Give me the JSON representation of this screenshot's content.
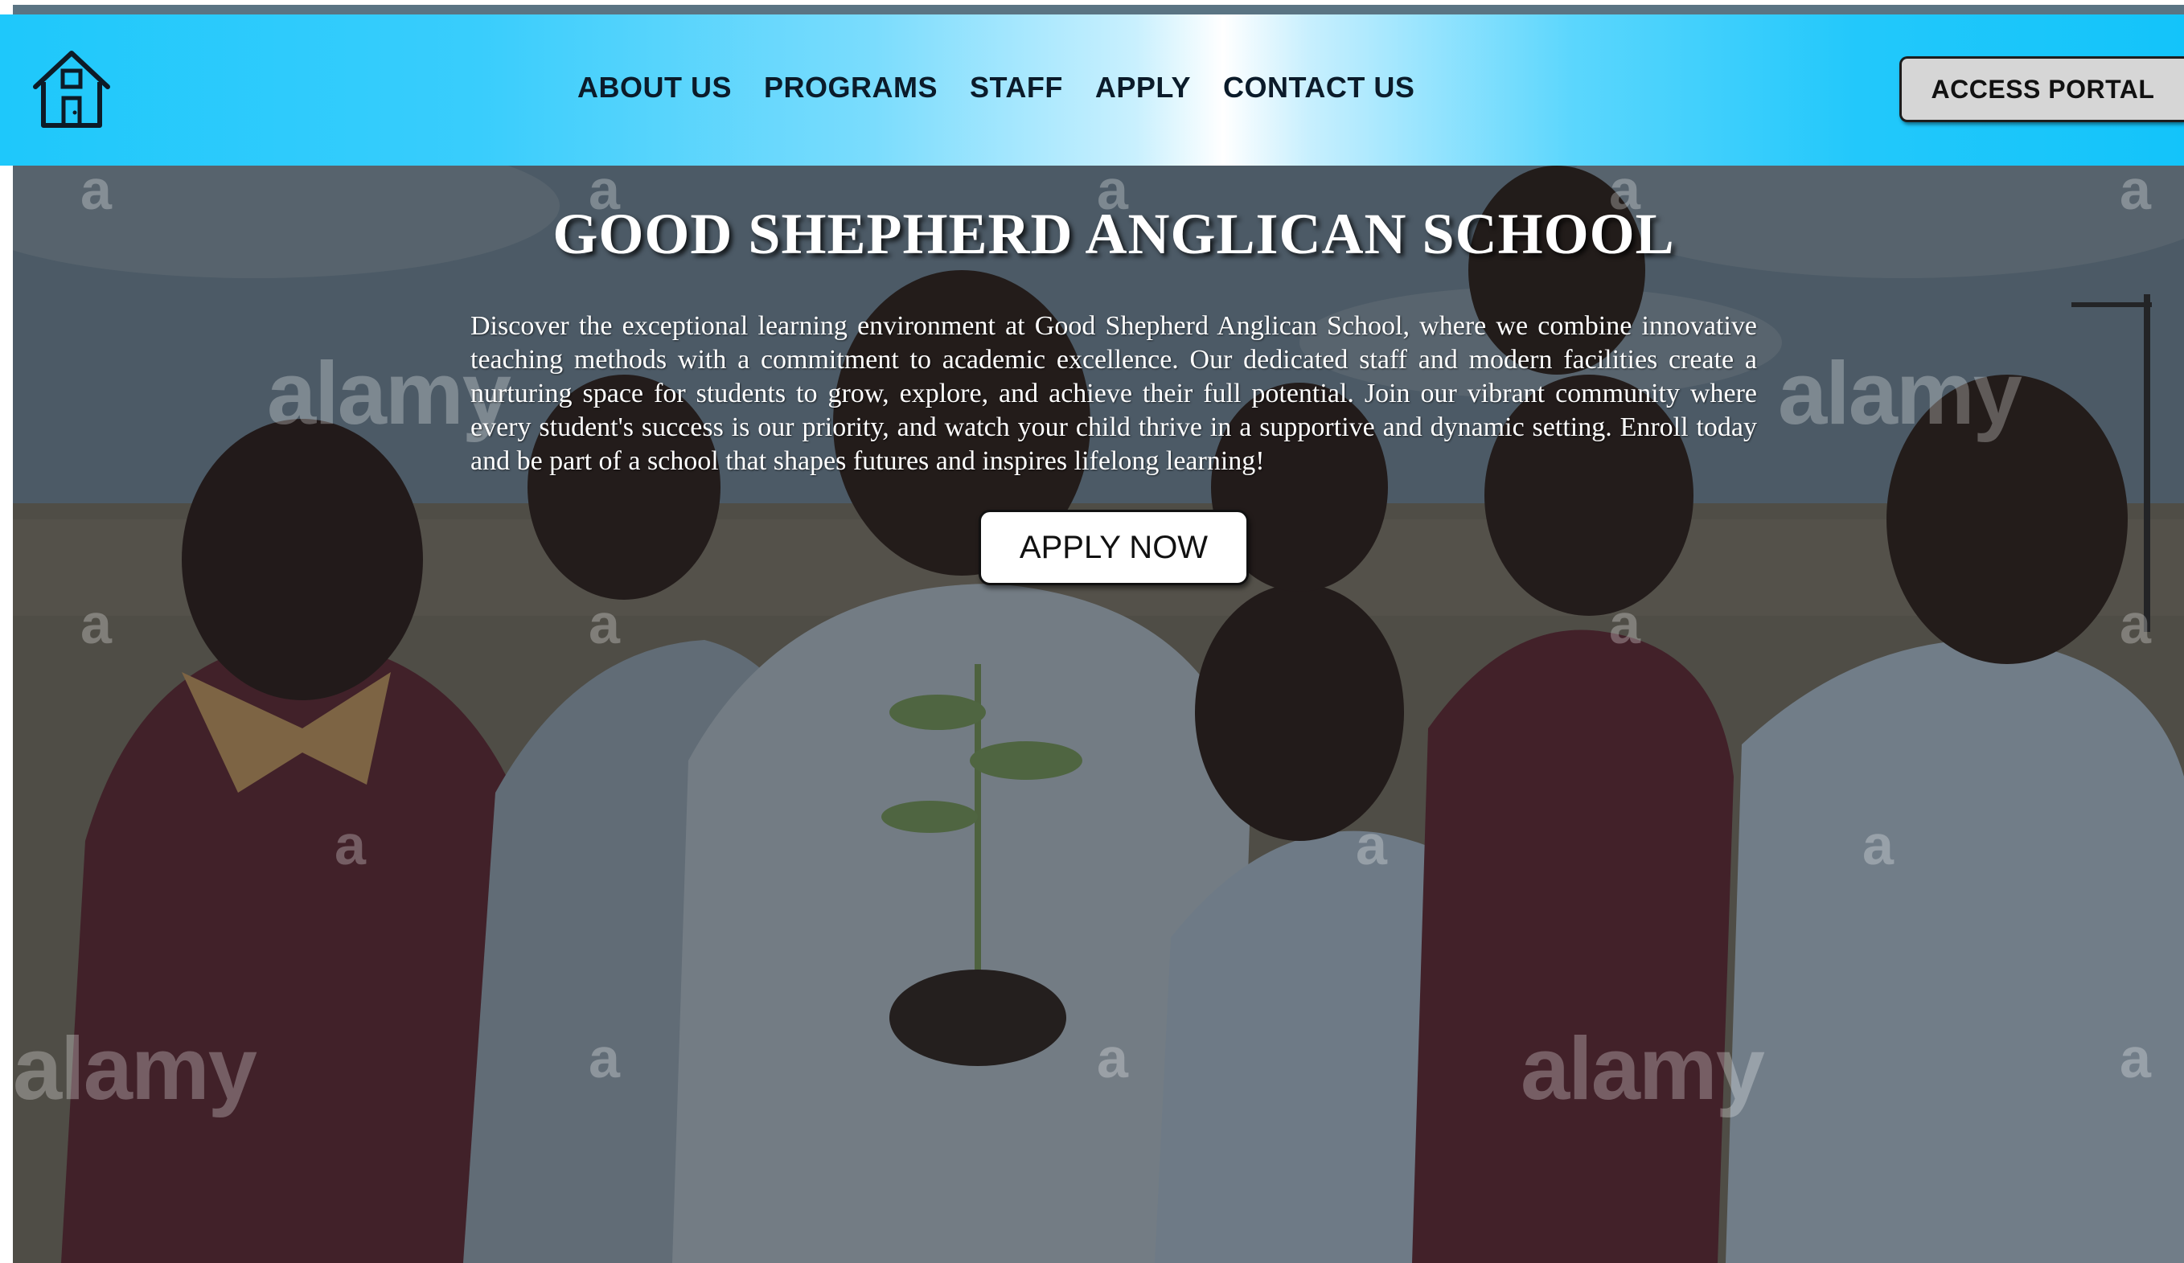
{
  "header": {
    "logo_icon": "house-icon",
    "nav": [
      {
        "label": "ABOUT US"
      },
      {
        "label": "PROGRAMS"
      },
      {
        "label": "STAFF"
      },
      {
        "label": "APPLY"
      },
      {
        "label": "CONTACT US"
      }
    ],
    "portal_label": "ACCESS PORTAL"
  },
  "hero": {
    "title": "GOOD SHEPHERD ANGLICAN SCHOOL",
    "intro": "Discover the exceptional learning environment at Good Shepherd Anglican School, where we combine innovative teaching methods with a commitment to academic excellence. Our dedicated staff and modern facilities create a nurturing space for students to grow, explore, and achieve their full potential. Join our vibrant community where every student's success is our priority, and watch your child thrive in a supportive and dynamic setting. Enroll today and be part of a school that shapes futures and inspires lifelong learning!",
    "cta_label": "APPLY NOW",
    "watermark_word": "alamy",
    "watermark_letter": "a"
  },
  "colors": {
    "header_edge": "#13c4fa",
    "header_center": "#ffffff",
    "portal_button": "#d6d6d6",
    "nav_text": "#0b1b2a"
  }
}
